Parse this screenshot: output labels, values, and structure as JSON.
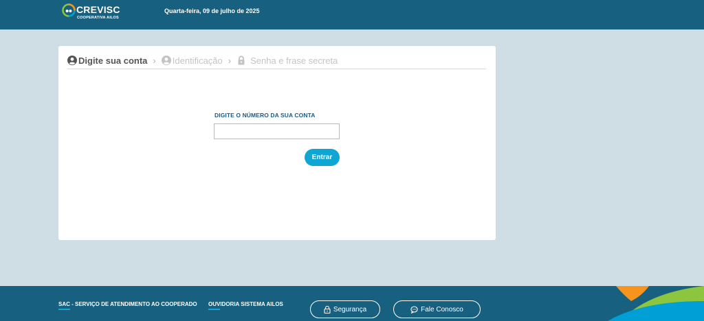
{
  "header": {
    "brand": "CREVISC",
    "brand_sub": "COOPERATIVA AILOS",
    "date": "Quarta-feira, 09 de julho de 2025"
  },
  "steps": [
    {
      "label": "Digite sua conta",
      "icon": "user-circle-icon",
      "active": true
    },
    {
      "label": "Identificação",
      "icon": "user-circle-icon",
      "active": false
    },
    {
      "label": "Senha e frase secreta",
      "icon": "lock-icon",
      "active": false
    }
  ],
  "step_separator": "›",
  "form": {
    "label": "DIGITE O NÚMERO DA SUA CONTA",
    "value": "",
    "placeholder": "",
    "submit_label": "Entrar"
  },
  "footer": {
    "sac": "SAC - SERVIÇO DE ATENDIMENTO AO COOPERADO",
    "ouvidoria": "OUVIDORIA SISTEMA AILOS",
    "seguranca": "Segurança",
    "fale_conosco": "Fale Conosco"
  },
  "colors": {
    "header_bg": "#17607f",
    "page_bg": "#cfdee5",
    "accent": "#0fa6d3",
    "label": "#1a5b86"
  }
}
